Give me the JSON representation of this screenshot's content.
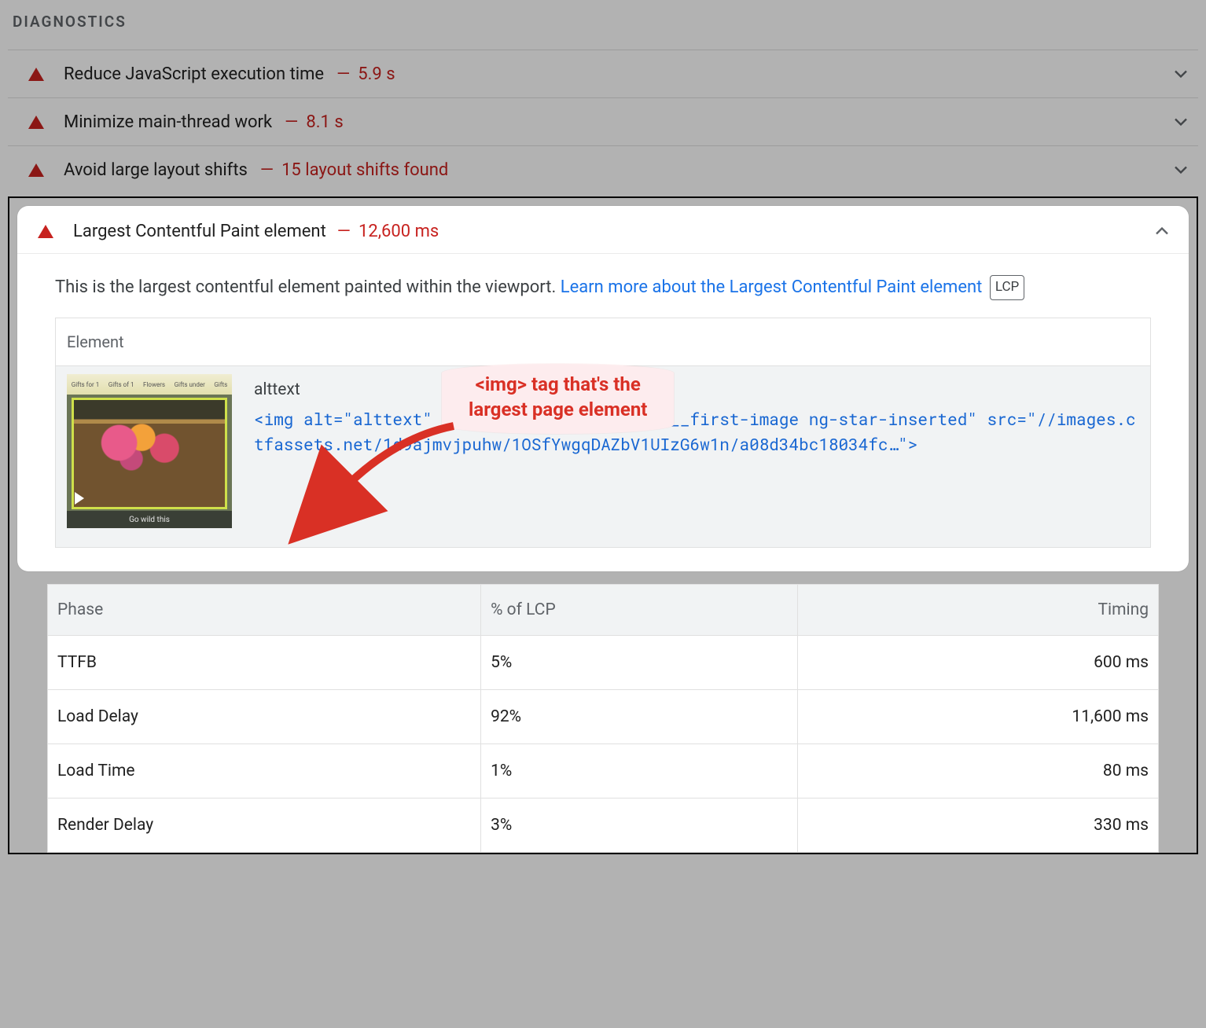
{
  "section_title": "DIAGNOSTICS",
  "audits": [
    {
      "title": "Reduce JavaScript execution time",
      "metric": "5.9 s"
    },
    {
      "title": "Minimize main-thread work",
      "metric": "8.1 s"
    },
    {
      "title": "Avoid large layout shifts",
      "metric": "15 layout shifts found"
    }
  ],
  "lcp": {
    "title": "Largest Contentful Paint element",
    "metric": "12,600 ms",
    "description_prefix": "This is the largest contentful element painted within the viewport. ",
    "learn_more": "Learn more about the Largest Contentful Paint element",
    "badge": "LCP",
    "element_header": "Element",
    "element_alt": "alttext",
    "element_code": "<img alt=\"alttext\" class=\"video-wrapper-v2__first-image ng-star-inserted\" src=\"//images.ctfassets.net/1d9ajmvjpuhw/1OSfYwgqDAZbV1UIzG6w1n/a08d34bc18034fc…\">"
  },
  "phase": {
    "headers": {
      "phase": "Phase",
      "pct": "% of LCP",
      "timing": "Timing"
    },
    "rows": [
      {
        "phase": "TTFB",
        "pct": "5%",
        "timing": "600 ms"
      },
      {
        "phase": "Load Delay",
        "pct": "92%",
        "timing": "11,600 ms"
      },
      {
        "phase": "Load Time",
        "pct": "1%",
        "timing": "80 ms"
      },
      {
        "phase": "Render Delay",
        "pct": "3%",
        "timing": "330 ms"
      }
    ]
  },
  "annotation": {
    "line1": "<img> tag that's the",
    "line2": "largest page element"
  },
  "dash": "—"
}
